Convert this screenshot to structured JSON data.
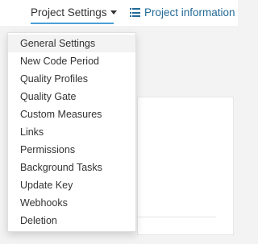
{
  "nav": {
    "project_settings_label": "Project Settings",
    "project_info_label": "Project information",
    "accent_color": "#4b9fd5",
    "link_color": "#236a97"
  },
  "dropdown": {
    "highlighted": "General Settings",
    "items": [
      {
        "label": "General Settings"
      },
      {
        "label": "New Code Period"
      },
      {
        "label": "Quality Profiles"
      },
      {
        "label": "Quality Gate"
      },
      {
        "label": "Custom Measures"
      },
      {
        "label": "Links"
      },
      {
        "label": "Permissions"
      },
      {
        "label": "Background Tasks"
      },
      {
        "label": "Update Key"
      },
      {
        "label": "Webhooks"
      },
      {
        "label": "Deletion"
      }
    ]
  }
}
